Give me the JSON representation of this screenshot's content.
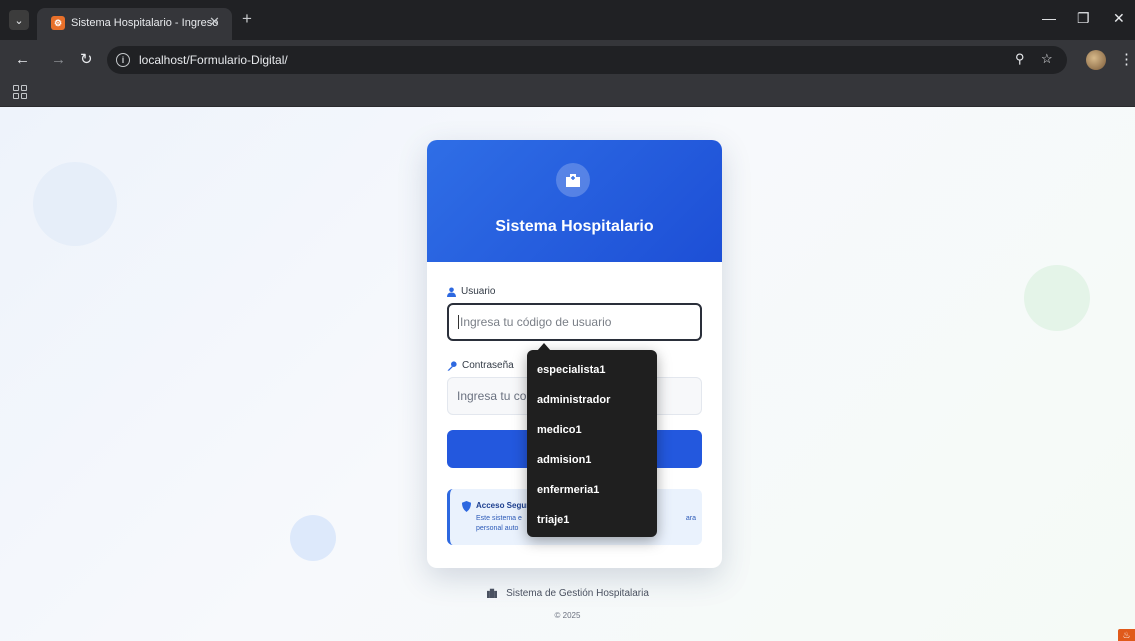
{
  "browser": {
    "tab_title": "Sistema Hospitalario - Ingreso",
    "url": "localhost/Formulario-Digital/",
    "icons": [
      "tab-menu-icon",
      "favicon-icon",
      "close-icon",
      "plus-icon",
      "minimize-icon",
      "restore-icon",
      "close-window-icon",
      "back-icon",
      "forward-icon",
      "reload-icon",
      "site-info-icon",
      "zoom-icon",
      "star-icon",
      "profile-avatar",
      "kebab-menu-icon",
      "apps-grid-icon"
    ]
  },
  "login": {
    "title": "Sistema Hospitalario",
    "username_label": "Usuario",
    "username_placeholder": "Ingresa tu código de usuario",
    "password_label": "Contraseña",
    "password_placeholder_visible": "Ingresa tu con",
    "notice_title": "Acceso Segur",
    "notice_body_left": "Este sistema e",
    "notice_body_left2": "personal auto",
    "notice_body_right": "ara",
    "accent_color": "#2358de"
  },
  "autocomplete": {
    "options": [
      "especialista1",
      "administrador",
      "medico1",
      "admision1",
      "enfermeria1",
      "triaje1"
    ]
  },
  "footer": {
    "system_name": "Sistema de Gestión Hospitalaria",
    "copyright": "© 2025"
  }
}
